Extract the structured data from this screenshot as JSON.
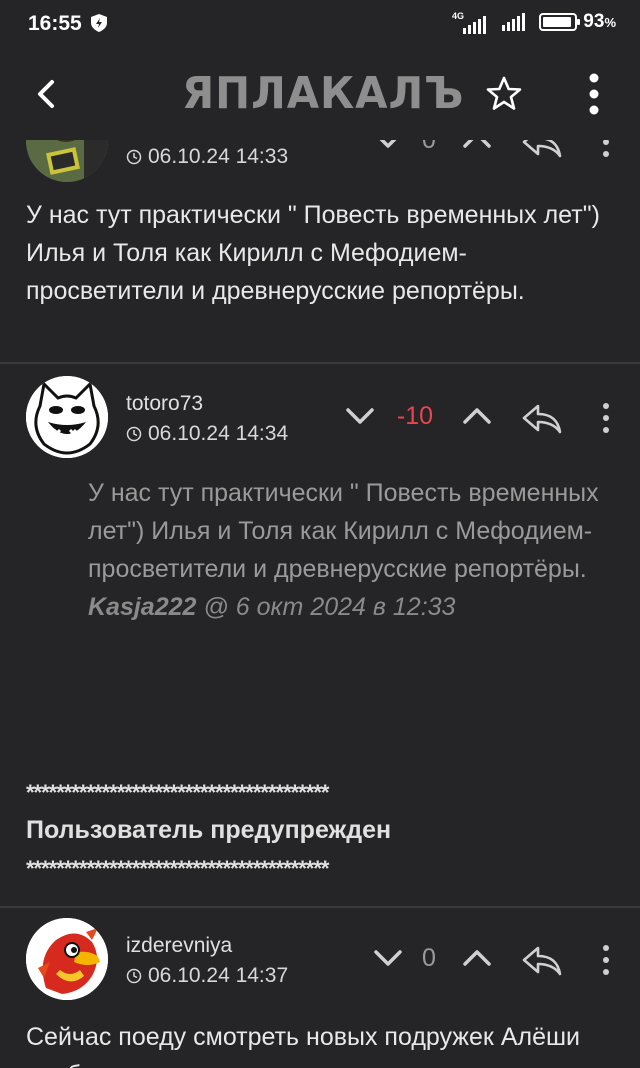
{
  "status_bar": {
    "time": "16:55",
    "network": "4G",
    "battery_percent": "93",
    "battery_suffix": "%",
    "battery_level": 0.93
  },
  "header": {
    "logo": "ЯПЛАКАЛЪ"
  },
  "comments": [
    {
      "username": "",
      "date": "06.10.24 14:33",
      "score": "0",
      "text": "У нас тут практически \" Повесть временных лет\") Илья и Толя как Кирилл с Мефодием-просветители и древнерусские репортёры."
    },
    {
      "username": "totoro73",
      "date": "06.10.24 14:34",
      "score": "-10",
      "quote_text": "У нас тут практически \" Повесть временных лет\") Илья и Толя как Кирилл с Мефодием-просветители и древнерусские репортёры.",
      "quote_author": "Kasja222",
      "quote_meta": "@ 6 окт 2024 в 12:33",
      "stars": "****************************************",
      "warning": "Пользователь предупрежден"
    },
    {
      "username": "izderevniya",
      "date": "06.10.24 14:37",
      "score": "0",
      "text": "Сейчас поеду смотреть новых подружек Алёши вообще стикурши в диске"
    }
  ],
  "colors": {
    "background": "#252527",
    "negative_score": "#e8454d",
    "divider": "#3a3a3c"
  },
  "icons": [
    "back-arrow-icon",
    "star-icon",
    "more-vertical-icon",
    "clock-icon",
    "chevron-down-icon",
    "chevron-up-icon",
    "reply-icon",
    "shield-icon"
  ]
}
